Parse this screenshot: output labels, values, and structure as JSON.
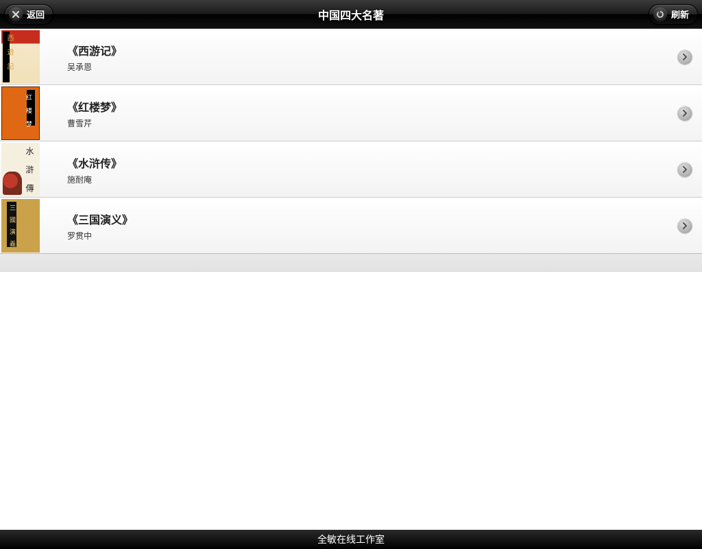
{
  "header": {
    "title": "中国四大名著",
    "back_label": "返回",
    "refresh_label": "刷新"
  },
  "books": [
    {
      "title": "《西游记》",
      "author": "吴承恩"
    },
    {
      "title": "《红楼梦》",
      "author": "曹雪芹"
    },
    {
      "title": "《水浒传》",
      "author": "施耐庵"
    },
    {
      "title": "《三国演义》",
      "author": "罗贯中"
    }
  ],
  "footer": {
    "text": "全敏在线工作室"
  }
}
